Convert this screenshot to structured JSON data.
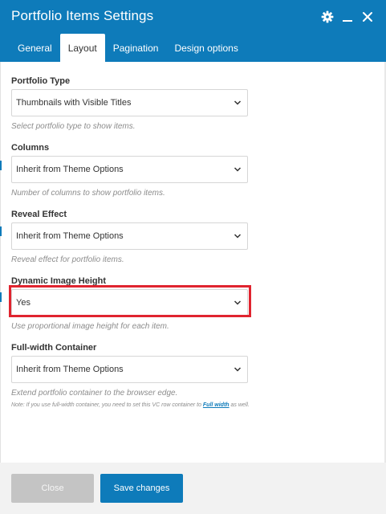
{
  "window": {
    "title": "Portfolio Items Settings"
  },
  "tabs": [
    {
      "label": "General",
      "active": false
    },
    {
      "label": "Layout",
      "active": true
    },
    {
      "label": "Pagination",
      "active": false
    },
    {
      "label": "Design options",
      "active": false
    }
  ],
  "fields": [
    {
      "label": "Portfolio Type",
      "value": "Thumbnails with Visible Titles",
      "hint": "Select portfolio type to show items."
    },
    {
      "label": "Columns",
      "value": "Inherit from Theme Options",
      "hint": "Number of columns to show portfolio items."
    },
    {
      "label": "Reveal Effect",
      "value": "Inherit from Theme Options",
      "hint": "Reveal effect for portfolio items."
    },
    {
      "label": "Dynamic Image Height",
      "value": "Yes",
      "hint": "Use proportional image height for each item.",
      "highlighted": true
    },
    {
      "label": "Full-width Container",
      "value": "Inherit from Theme Options",
      "hint": "Extend portfolio container to the browser edge."
    }
  ],
  "note": {
    "before": "Note: If you use full-width container, you need to set this VC row container to ",
    "link": "Full width",
    "after": " as well."
  },
  "footer": {
    "close_label": "Close",
    "save_label": "Save changes"
  },
  "icons": {
    "settings": "gear-icon",
    "minimize": "minimize-icon",
    "close": "close-icon",
    "dropdown": "chevron-down-icon"
  },
  "colors": {
    "header": "#0e7bba",
    "highlight": "#e0242f",
    "save_button": "#0e7bba",
    "close_button": "#c4c4c4"
  }
}
